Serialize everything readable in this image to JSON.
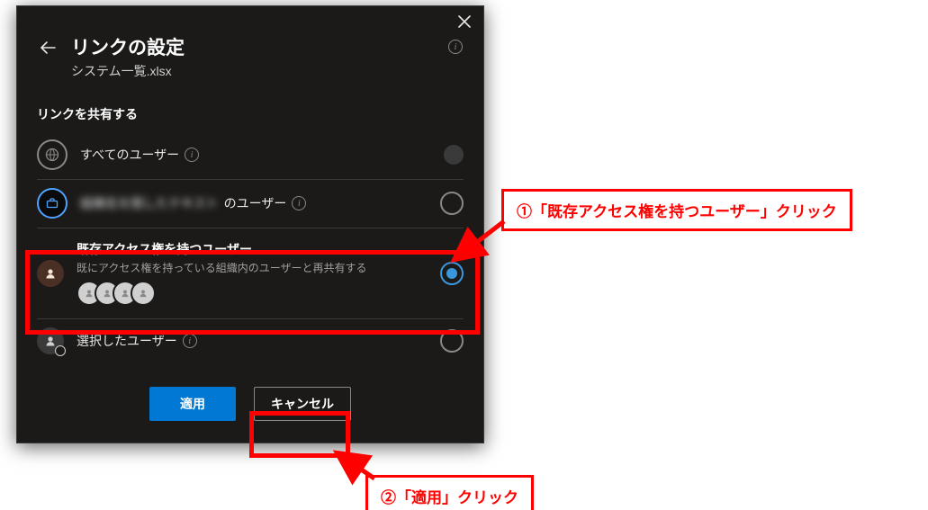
{
  "dialog": {
    "title": "リンクの設定",
    "subtitle": "システム一覧.xlsx",
    "section_label": "リンクを共有する",
    "options": {
      "anyone": {
        "label": "すべてのユーザー"
      },
      "org": {
        "label_suffix": "のユーザー",
        "label_hidden": "組織名を隠したテキスト"
      },
      "existing": {
        "label": "既存アクセス権を持つユーザー",
        "desc": "既にアクセス権を持っている組織内のユーザーと再共有する"
      },
      "specific": {
        "label": "選択したユーザー"
      }
    },
    "actions": {
      "apply": "適用",
      "cancel": "キャンセル"
    }
  },
  "annotations": {
    "step1": "①「既存アクセス権を持つユーザー」クリック",
    "step2": "②「適用」クリック"
  },
  "colors": {
    "accent": "#0078d4",
    "highlight": "#ff0000",
    "radio_selected": "#3a96dd"
  }
}
